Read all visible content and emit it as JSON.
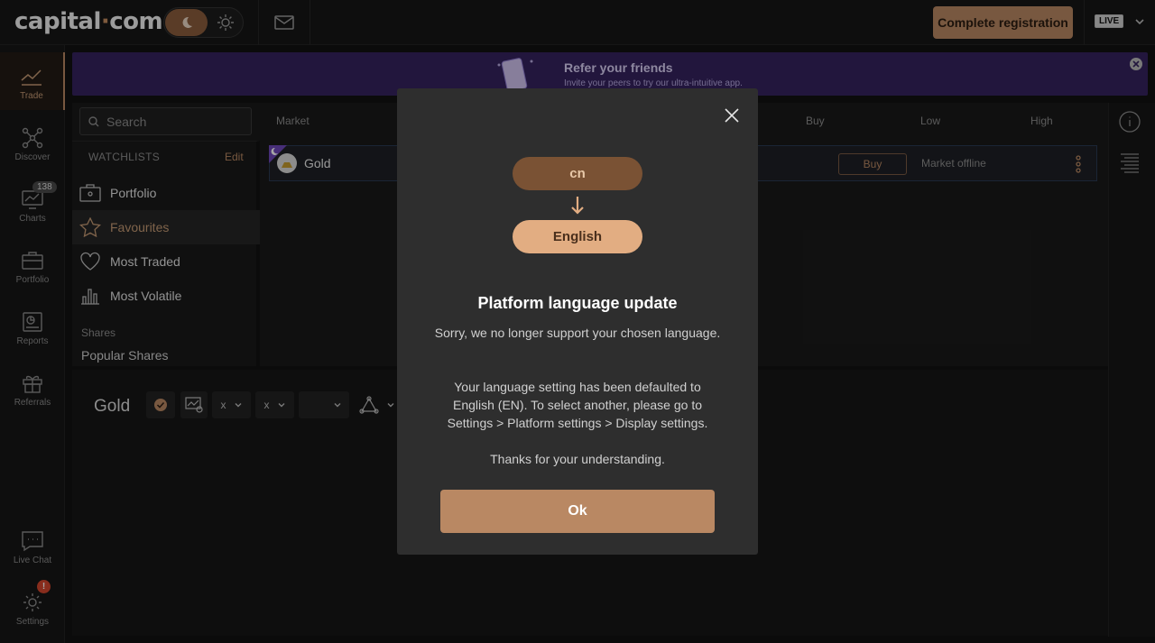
{
  "header": {
    "logo_text": "capital",
    "logo_dot": "·",
    "logo_suffix": "com",
    "register_label": "Complete registration",
    "account_badge": "LIVE"
  },
  "sidebar": {
    "items": [
      {
        "label": "Trade",
        "icon": "trend-icon"
      },
      {
        "label": "Discover",
        "icon": "network-icon"
      },
      {
        "label": "Charts",
        "icon": "chart-monitor-icon",
        "badge": "138"
      },
      {
        "label": "Portfolio",
        "icon": "briefcase-icon"
      },
      {
        "label": "Reports",
        "icon": "report-icon"
      },
      {
        "label": "Referrals",
        "icon": "gift-icon"
      },
      {
        "label": "Live Chat",
        "icon": "chat-icon"
      },
      {
        "label": "Settings",
        "icon": "gear-icon",
        "alert": "!"
      }
    ]
  },
  "banner": {
    "title": "Refer your friends",
    "subtitle": "Invite your peers to try our ultra-intuitive app."
  },
  "market": {
    "search_placeholder": "Search",
    "columns": {
      "market": "Market",
      "buy": "Buy",
      "low": "Low",
      "high": "High"
    },
    "watchlists_label": "WATCHLISTS",
    "edit_label": "Edit",
    "watchlists": [
      "Portfolio",
      "Favourites",
      "Most Traded",
      "Most Volatile"
    ],
    "section_label": "Shares",
    "section_item": "Popular Shares",
    "row": {
      "name": "Gold",
      "buy_label": "Buy",
      "status": "Market offline"
    }
  },
  "chart": {
    "instrument": "Gold",
    "select_a": "x",
    "select_b": "x"
  },
  "modal": {
    "from_lang": "cn",
    "to_lang": "English",
    "title": "Platform language update",
    "p1": "Sorry, we no longer support your chosen language.",
    "p2": "Your language setting has been defaulted to English (EN). To select another, please go to Settings > Platform settings > Display settings.",
    "p3": "Thanks for your understanding.",
    "ok_label": "Ok"
  },
  "colors": {
    "accent": "#b98863",
    "banner": "#35235e",
    "alert": "#d2452d"
  }
}
